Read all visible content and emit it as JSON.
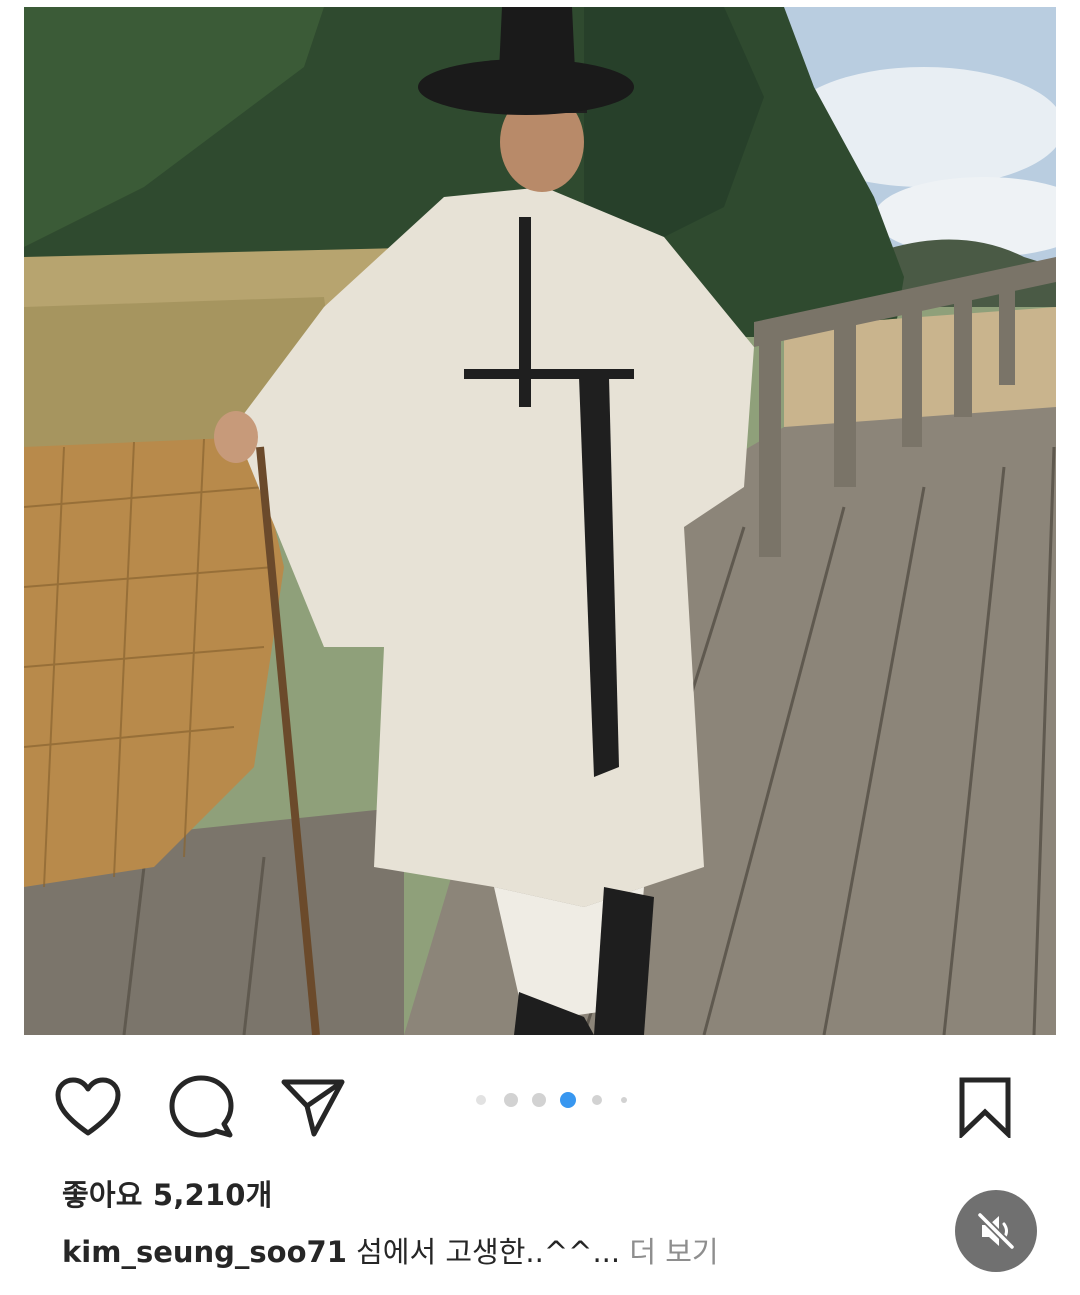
{
  "post": {
    "image_alt": "Man in white hanbok and black gat standing on a wooden bridge holding a walking stick",
    "carousel": {
      "total": 6,
      "active_index": 3
    },
    "likes_text": "좋아요 5,210개",
    "caption": {
      "username": "kim_seung_soo71",
      "text": "섬에서 고생한..^^...",
      "more_label": "더 보기"
    }
  },
  "icons": {
    "like": "heart-outline-icon",
    "comment": "comment-bubble-icon",
    "share": "paper-plane-icon",
    "save": "bookmark-outline-icon",
    "mute": "speaker-muted-icon"
  },
  "colors": {
    "text": "#262626",
    "muted_text": "#8e8e8e",
    "active_dot": "#3897f0",
    "inactive_dot": "#d2d2d2",
    "mute_badge": "#707070"
  }
}
